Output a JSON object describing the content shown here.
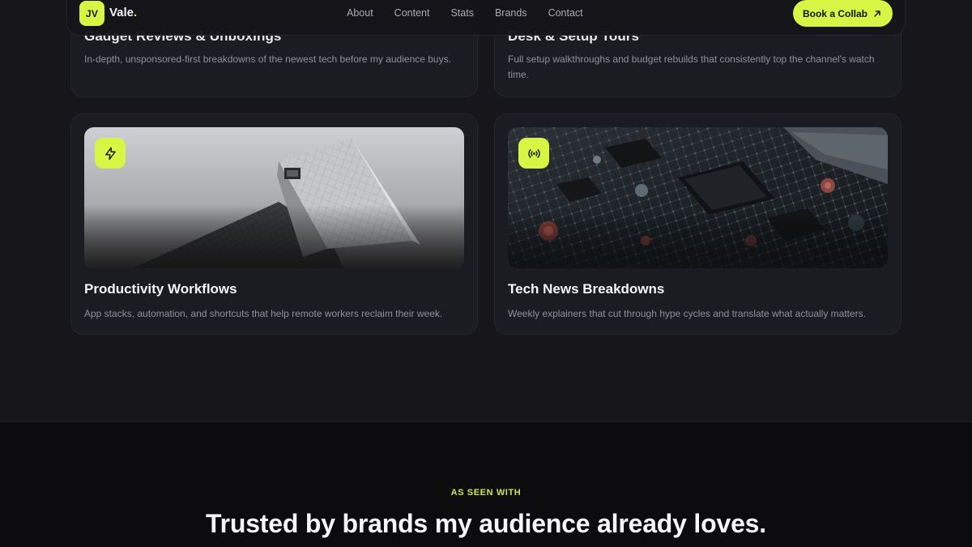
{
  "header": {
    "logo_initials": "JV",
    "logo_name": "Vale",
    "logo_dot": ".",
    "nav": [
      {
        "label": "About"
      },
      {
        "label": "Content"
      },
      {
        "label": "Stats"
      },
      {
        "label": "Brands"
      },
      {
        "label": "Contact"
      }
    ],
    "cta_label": "Book a Collab",
    "cta_icon": "arrow-up-right-icon"
  },
  "cards_partial": [
    {
      "title": "Gadget Reviews & Unboxings",
      "description": "In-depth, unsponsored-first breakdowns of the newest tech before my audience buys."
    },
    {
      "title": "Desk & Setup Tours",
      "description": "Full setup walkthroughs and budget rebuilds that consistently top the channel's watch time."
    }
  ],
  "cards": [
    {
      "title": "Productivity Workflows",
      "description": "App stacks, automation, and shortcuts that help remote workers reclaim their week.",
      "icon": "lightning-bolt-icon",
      "image": "modern-architecture-photo"
    },
    {
      "title": "Tech News Breakdowns",
      "description": "Weekly explainers that cut through hype cycles and translate what actually matters.",
      "icon": "broadcast-icon",
      "image": "circuit-board-photo"
    }
  ],
  "trusted": {
    "eyebrow": "AS SEEN WITH",
    "headline": "Trusted by brands my audience already loves."
  },
  "colors": {
    "accent": "#d7f544",
    "background": "#16161b",
    "card": "#1b1c22",
    "section_dark": "#0c0c0f"
  }
}
